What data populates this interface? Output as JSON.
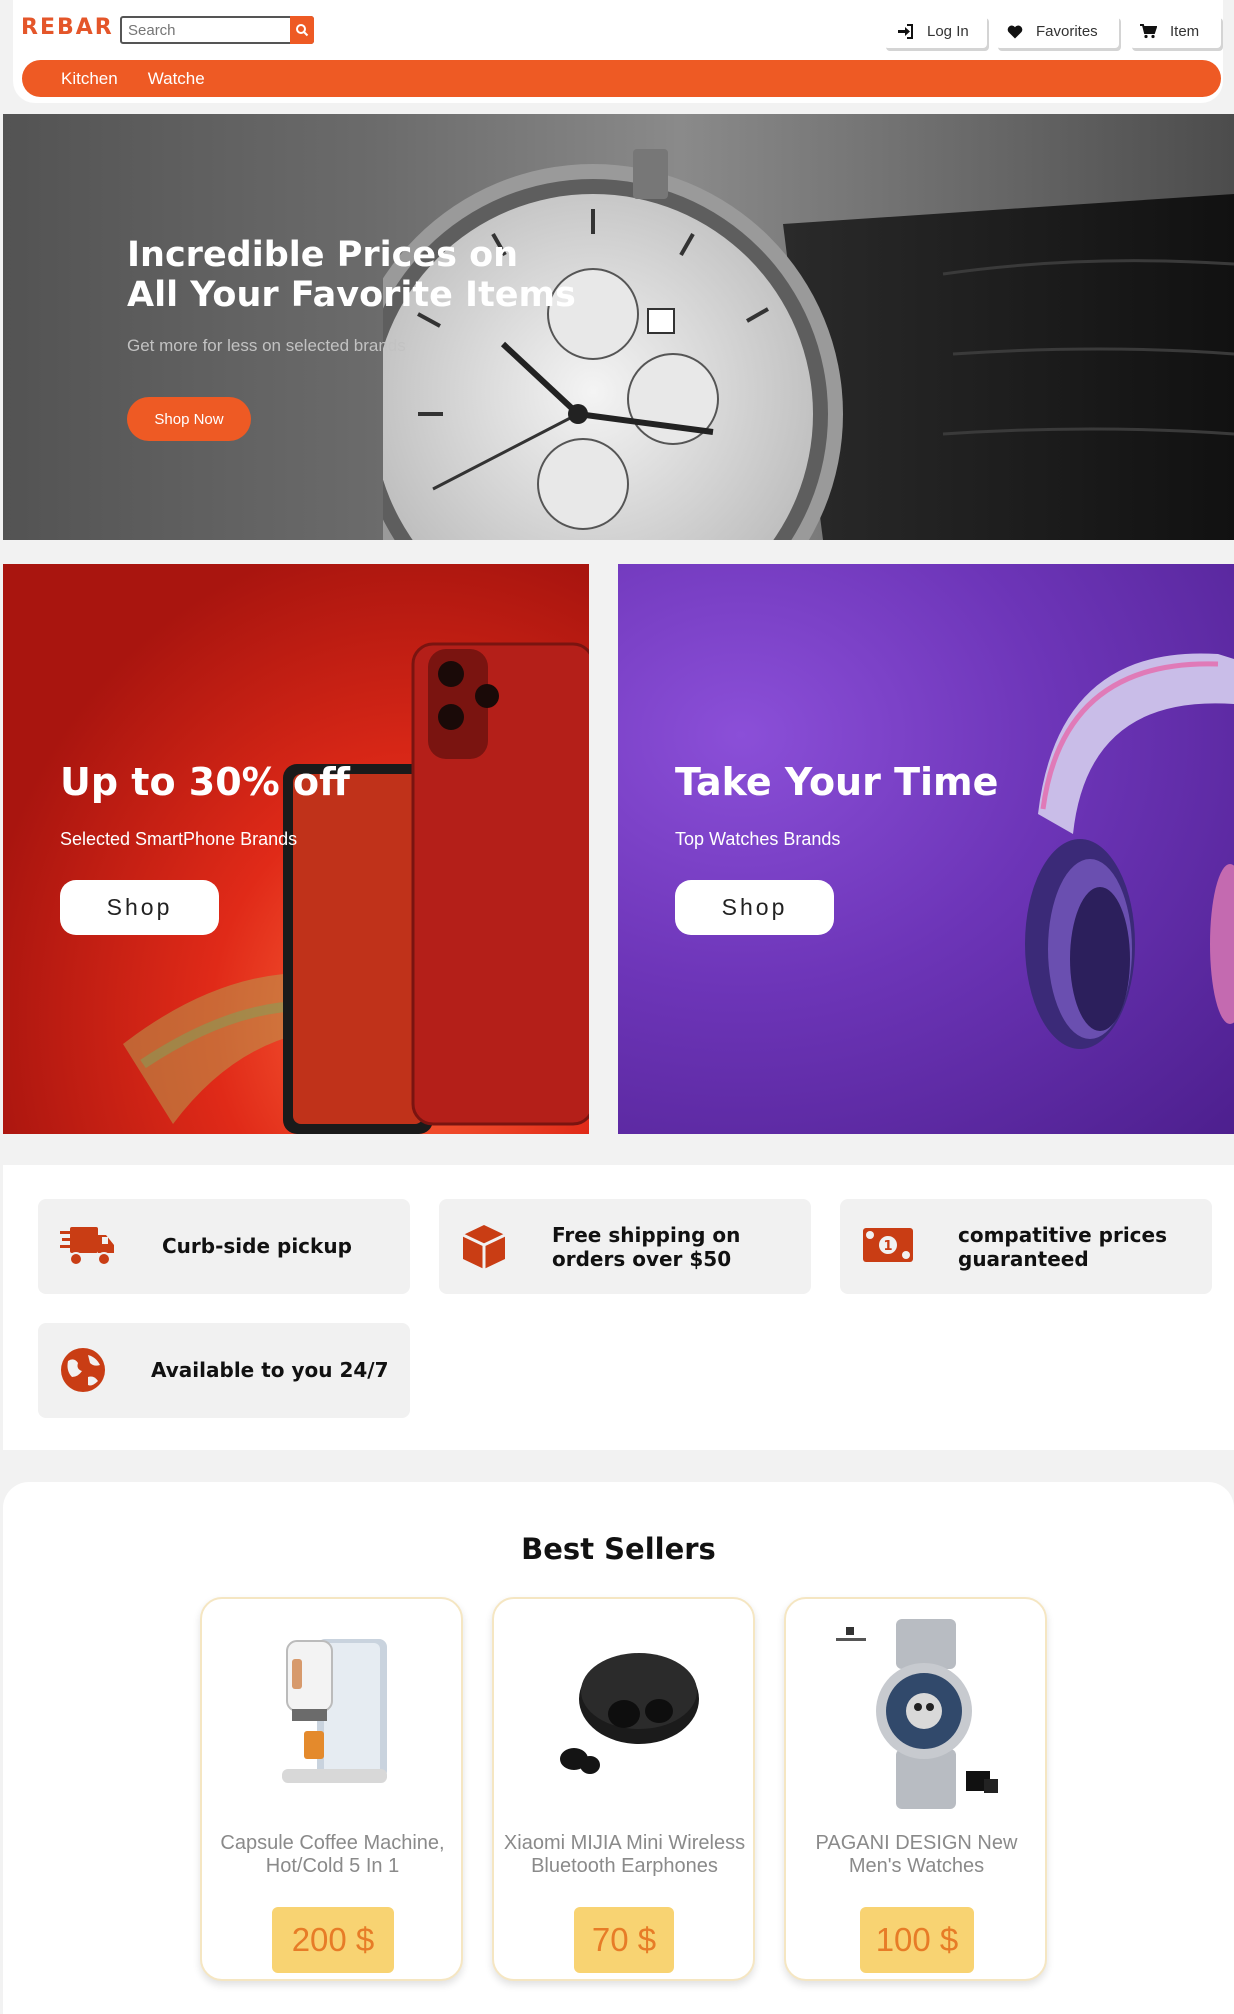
{
  "header": {
    "logo": "REBAR",
    "search_placeholder": "Search",
    "login_label": "Log In",
    "favorites_label": "Favorites",
    "cart_label": "Item"
  },
  "nav": {
    "items": [
      {
        "label": "Kitchen"
      },
      {
        "label": "Watche"
      }
    ]
  },
  "hero": {
    "title": "Incredible Prices on All Your Favorite Items",
    "subtitle": "Get more for less on selected brands",
    "button_label": "Shop Now"
  },
  "promos": [
    {
      "title": "Up to 30% off",
      "subtitle": "Selected SmartPhone Brands",
      "button_label": "Shop"
    },
    {
      "title": "Take Your Time",
      "subtitle": "Top Watches Brands",
      "button_label": "Shop"
    }
  ],
  "features": [
    {
      "label": "Curb-side pickup",
      "icon": "truck-icon"
    },
    {
      "label": "Free shipping on orders over $50",
      "icon": "box-icon"
    },
    {
      "label": "compatitive prices guaranteed",
      "icon": "money-icon"
    },
    {
      "label": "Available to you 24/7",
      "icon": "globe-icon"
    }
  ],
  "best_sellers": {
    "title": "Best Sellers",
    "products": [
      {
        "name": "Capsule Coffee Machine, Hot/Cold 5 In 1",
        "price": "200 $"
      },
      {
        "name": "Xiaomi MIJIA Mini Wireless Bluetooth Earphones",
        "price": "70 $"
      },
      {
        "name": "PAGANI DESIGN New Men's Watches",
        "price": "100 $"
      }
    ]
  },
  "colors": {
    "accent": "#ee5a24",
    "price_bg": "#f8d372",
    "price_text": "#e77c27"
  }
}
